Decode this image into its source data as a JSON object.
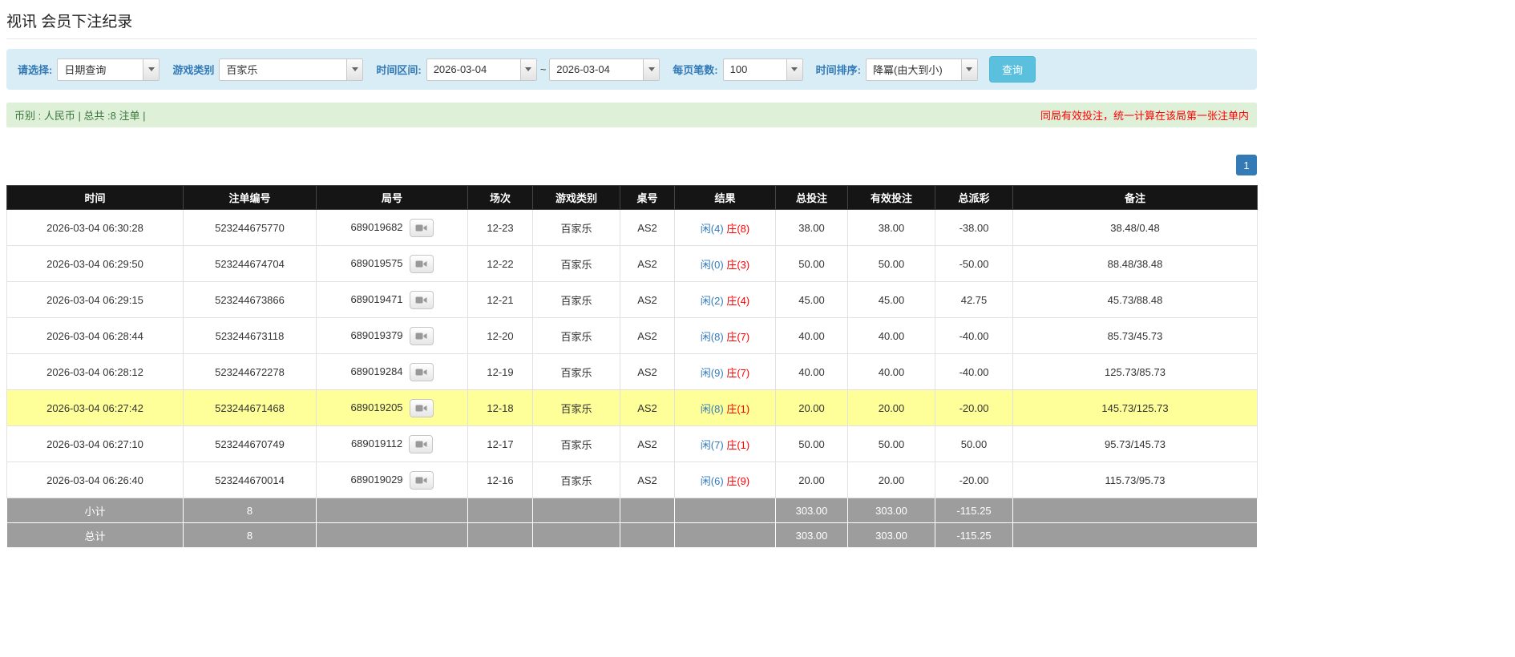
{
  "page": {
    "title": "视讯 会员下注纪录"
  },
  "filters": {
    "select_label": "请选择:",
    "select_value": "日期查询",
    "game_type_label": "游戏类别",
    "game_type_value": "百家乐",
    "time_range_label": "时间区间:",
    "date_from": "2026-03-04",
    "range_separator": "~",
    "date_to": "2026-03-04",
    "per_page_label": "每页笔数:",
    "per_page_value": "100",
    "sort_label": "时间排序:",
    "sort_value": "降冪(由大到小)",
    "search_button": "查询"
  },
  "summary": {
    "left": "币别 : 人民币 | 总共 :8 注单 |",
    "right": "同局有效投注，统一计算在该局第一张注单内"
  },
  "pagination": {
    "current": "1"
  },
  "table": {
    "headers": [
      "时间",
      "注单编号",
      "局号",
      "场次",
      "游戏类别",
      "桌号",
      "结果",
      "总投注",
      "有效投注",
      "总派彩",
      "备注"
    ],
    "rows": [
      {
        "time": "2026-03-04 06:30:28",
        "bet_id": "523244675770",
        "round": "689019682",
        "session": "12-23",
        "game": "百家乐",
        "table_no": "AS2",
        "result_player": "闲(4)",
        "result_banker": "庄(8)",
        "total_bet": "38.00",
        "valid_bet": "38.00",
        "payout": "-38.00",
        "note": "38.48/0.48",
        "highlight": false
      },
      {
        "time": "2026-03-04 06:29:50",
        "bet_id": "523244674704",
        "round": "689019575",
        "session": "12-22",
        "game": "百家乐",
        "table_no": "AS2",
        "result_player": "闲(0)",
        "result_banker": "庄(3)",
        "total_bet": "50.00",
        "valid_bet": "50.00",
        "payout": "-50.00",
        "note": "88.48/38.48",
        "highlight": false
      },
      {
        "time": "2026-03-04 06:29:15",
        "bet_id": "523244673866",
        "round": "689019471",
        "session": "12-21",
        "game": "百家乐",
        "table_no": "AS2",
        "result_player": "闲(2)",
        "result_banker": "庄(4)",
        "total_bet": "45.00",
        "valid_bet": "45.00",
        "payout": "42.75",
        "note": "45.73/88.48",
        "highlight": false
      },
      {
        "time": "2026-03-04 06:28:44",
        "bet_id": "523244673118",
        "round": "689019379",
        "session": "12-20",
        "game": "百家乐",
        "table_no": "AS2",
        "result_player": "闲(8)",
        "result_banker": "庄(7)",
        "total_bet": "40.00",
        "valid_bet": "40.00",
        "payout": "-40.00",
        "note": "85.73/45.73",
        "highlight": false
      },
      {
        "time": "2026-03-04 06:28:12",
        "bet_id": "523244672278",
        "round": "689019284",
        "session": "12-19",
        "game": "百家乐",
        "table_no": "AS2",
        "result_player": "闲(9)",
        "result_banker": "庄(7)",
        "total_bet": "40.00",
        "valid_bet": "40.00",
        "payout": "-40.00",
        "note": "125.73/85.73",
        "highlight": false
      },
      {
        "time": "2026-03-04 06:27:42",
        "bet_id": "523244671468",
        "round": "689019205",
        "session": "12-18",
        "game": "百家乐",
        "table_no": "AS2",
        "result_player": "闲(8)",
        "result_banker": "庄(1)",
        "total_bet": "20.00",
        "valid_bet": "20.00",
        "payout": "-20.00",
        "note": "145.73/125.73",
        "highlight": true
      },
      {
        "time": "2026-03-04 06:27:10",
        "bet_id": "523244670749",
        "round": "689019112",
        "session": "12-17",
        "game": "百家乐",
        "table_no": "AS2",
        "result_player": "闲(7)",
        "result_banker": "庄(1)",
        "total_bet": "50.00",
        "valid_bet": "50.00",
        "payout": "50.00",
        "note": "95.73/145.73",
        "highlight": false
      },
      {
        "time": "2026-03-04 06:26:40",
        "bet_id": "523244670014",
        "round": "689019029",
        "session": "12-16",
        "game": "百家乐",
        "table_no": "AS2",
        "result_player": "闲(6)",
        "result_banker": "庄(9)",
        "total_bet": "20.00",
        "valid_bet": "20.00",
        "payout": "-20.00",
        "note": "115.73/95.73",
        "highlight": false
      }
    ],
    "footer": [
      {
        "label": "小计",
        "count": "8",
        "total_bet": "303.00",
        "valid_bet": "303.00",
        "payout": "-115.25"
      },
      {
        "label": "总计",
        "count": "8",
        "total_bet": "303.00",
        "valid_bet": "303.00",
        "payout": "-115.25"
      }
    ]
  },
  "icons": {
    "video_replay": "video-camera",
    "combo_arrow": "caret-down"
  },
  "colors": {
    "filter_bar_bg": "#d9edf7",
    "filter_label_blue": "#337ab7",
    "search_button_bg": "#5bc0de",
    "summary_bar_bg": "#dff0d8",
    "summary_text_green": "#3c763d",
    "notice_red": "#ff0000",
    "pagination_active_bg": "#337ab7",
    "table_header_bg": "#151515",
    "highlight_row_yellow": "#ffff99",
    "link_blue": "#337ab7",
    "banker_red": "#ff0000",
    "negative_red": "#ff0000",
    "footer_row_gray": "#9d9d9d"
  }
}
